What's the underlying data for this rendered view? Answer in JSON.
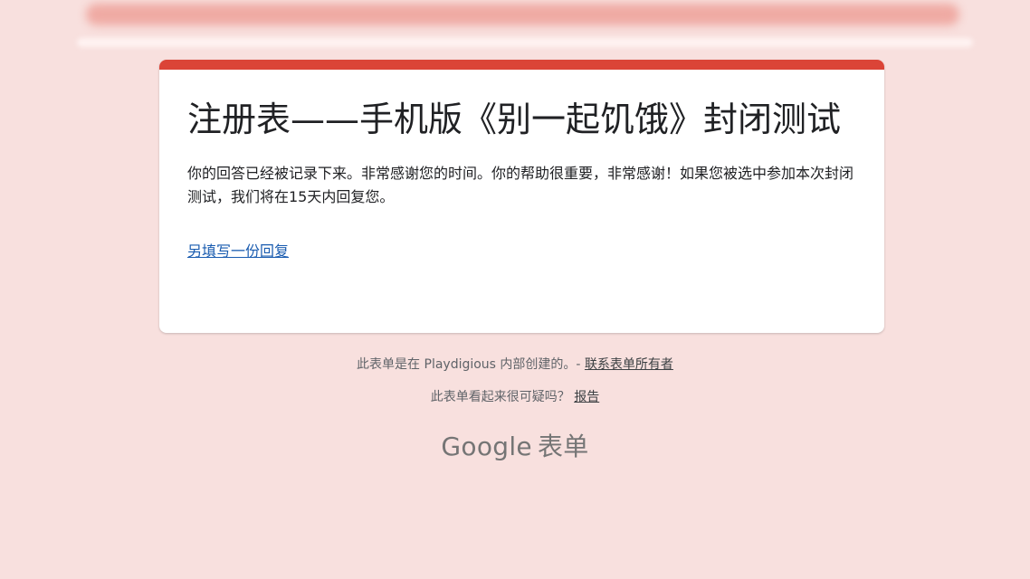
{
  "card": {
    "accent_color": "#db4437",
    "title": "注册表——手机版《别一起饥饿》封闭测试",
    "confirmation": "你的回答已经被记录下来。非常感谢您的时间。你的帮助很重要，非常感谢！如果您被选中参加本次封闭测试，我们将在15天内回复您。",
    "another_response_link": "另填写一份回复"
  },
  "footer": {
    "created_text": "此表单是在 Playdigious 内部创建的。-",
    "contact_owner_link": "联系表单所有者",
    "suspicious_text": "此表单看起来很可疑吗？",
    "report_link": "报告"
  },
  "logo": {
    "brand": "Google",
    "product": "表单"
  }
}
